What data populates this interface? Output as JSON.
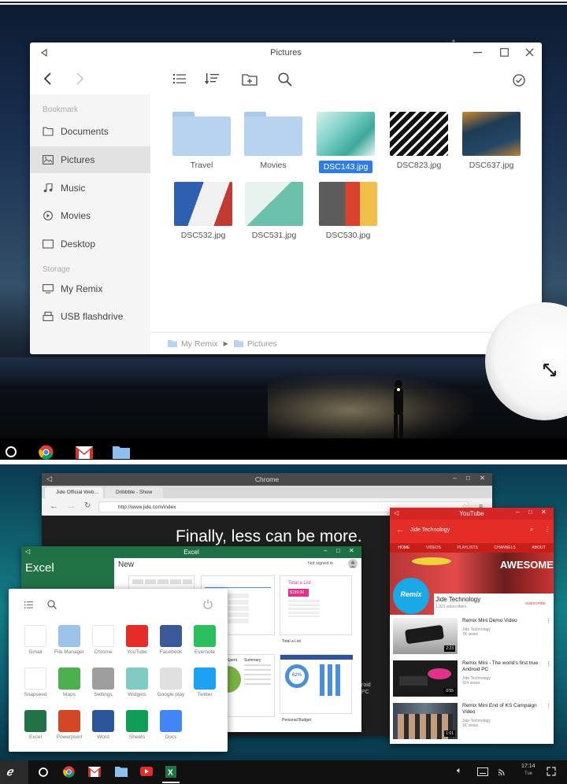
{
  "top": {
    "file_manager": {
      "title": "Pictures",
      "sidebar": {
        "bookmark_label": "Bookmark",
        "bookmarks": [
          "Documents",
          "Pictures",
          "Music",
          "Movies",
          "Desktop"
        ],
        "storage_label": "Storage",
        "storage": [
          "My Remix",
          "USB flashdrive"
        ]
      },
      "files": [
        {
          "name": "Travel",
          "kind": "folder"
        },
        {
          "name": "Movies",
          "kind": "folder"
        },
        {
          "name": "DSC143.jpg",
          "kind": "image",
          "selected": true
        },
        {
          "name": "DSC823.jpg",
          "kind": "image"
        },
        {
          "name": "DSC637.jpg",
          "kind": "image"
        },
        {
          "name": "DSC532.jpg",
          "kind": "image"
        },
        {
          "name": "DSC531.jpg",
          "kind": "image"
        },
        {
          "name": "DSC530.jpg",
          "kind": "image"
        }
      ],
      "breadcrumb": [
        "My Remix",
        "Pictures"
      ]
    },
    "taskbar_icons": [
      "home-circle-icon",
      "chrome-icon",
      "gmail-icon",
      "folder-icon"
    ]
  },
  "bottom": {
    "chrome": {
      "title": "Chrome",
      "tabs": [
        "Jide Official Web...",
        "Dribbble - Show"
      ],
      "url": "http://www.jide.com/index",
      "hero_text": "Finally, less can be more.",
      "side_snippet": "roid\nPC"
    },
    "excel": {
      "title": "Excel",
      "app_name": "Excel",
      "new_label": "New",
      "signin": "Not signed in",
      "cards": {
        "total_list": "Total a List",
        "total_list_amount": "$139.00",
        "spent": "Spent",
        "summary": "Summary",
        "budget_pct": "62%",
        "personal_budget": "Personal Budget"
      }
    },
    "youtube": {
      "title": "YouTube",
      "channel": "Jide Technology",
      "tabs": [
        "HOME",
        "VIDEOS",
        "PLAYLISTS",
        "CHANNELS",
        "ABOUT"
      ],
      "banner_text": "AWESOME",
      "logo_text": "Remix",
      "channel_name": "Jide Technology",
      "subscribers": "1,921 subscribers",
      "subscribe": "SUBSCRIBE",
      "videos": [
        {
          "title": "Remix Mini Demo Video",
          "channel": "Jide Technology",
          "views": "7K views",
          "duration": "2:23"
        },
        {
          "title": "Remix Mini - The world's first true Android PC",
          "channel": "Jide Technology",
          "views": "924 views",
          "duration": "0:55"
        },
        {
          "title": "Remix Mini End of KS Campaign Video",
          "channel": "Jide Technology",
          "views": "1K views",
          "duration": "1:01"
        }
      ]
    },
    "launcher": {
      "apps": [
        {
          "name": "Gmail",
          "color": "#ffffff"
        },
        {
          "name": "File Manager",
          "color": "#9ec3ea"
        },
        {
          "name": "Chrome",
          "color": "#ffffff"
        },
        {
          "name": "YouTube",
          "color": "#e52d27"
        },
        {
          "name": "Facebook",
          "color": "#3b5998"
        },
        {
          "name": "Evernote",
          "color": "#2dbe60"
        },
        {
          "name": "Snapseed",
          "color": "#ffffff"
        },
        {
          "name": "Maps",
          "color": "#4caf50"
        },
        {
          "name": "Settings",
          "color": "#9e9e9e"
        },
        {
          "name": "Widgets",
          "color": "#80cbc4"
        },
        {
          "name": "Google play",
          "color": "#e0e0e0"
        },
        {
          "name": "Twitter",
          "color": "#1da1f2"
        },
        {
          "name": "Excel",
          "color": "#217346"
        },
        {
          "name": "Powerpoint",
          "color": "#d24726"
        },
        {
          "name": "Word",
          "color": "#2b579a"
        },
        {
          "name": "Sheets",
          "color": "#0f9d58"
        },
        {
          "name": "Docs",
          "color": "#4285f4"
        }
      ]
    },
    "taskbar": {
      "time": "17:14",
      "day": "Tue"
    }
  }
}
